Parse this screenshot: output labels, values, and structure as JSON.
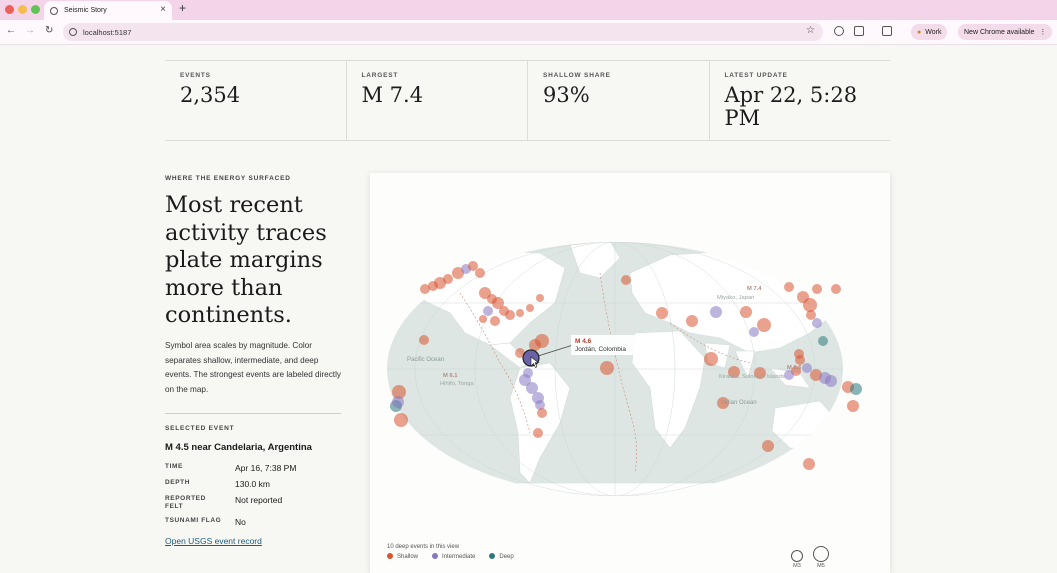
{
  "browser": {
    "tab_title": "Seismic Story",
    "url": "localhost:5187",
    "profile_label": "Work",
    "update_label": "New Chrome available"
  },
  "stats": [
    {
      "label": "EVENTS",
      "value": "2,354"
    },
    {
      "label": "LARGEST",
      "value": "M 7.4"
    },
    {
      "label": "SHALLOW SHARE",
      "value": "93%"
    },
    {
      "label": "LATEST UPDATE",
      "value": "Apr 22, 5:28 PM"
    }
  ],
  "story": {
    "kicker": "WHERE THE ENERGY SURFACED",
    "headline": "Most recent activity traces plate margins more than continents.",
    "description": "Symbol area scales by magnitude. Color separates shallow, intermediate, and deep events. The strongest events are labeled directly on the map."
  },
  "selected": {
    "section_label": "SELECTED EVENT",
    "title": "M 4.5 near Candelaria, Argentina",
    "fields": [
      {
        "key": "TIME",
        "value": "Apr 16, 7:38 PM"
      },
      {
        "key": "DEPTH",
        "value": "130.0 km"
      },
      {
        "key": "REPORTED FELT",
        "value": "Not reported"
      },
      {
        "key": "TSUNAMI FLAG",
        "value": "No"
      }
    ],
    "link_text": "Open USGS event record"
  },
  "map": {
    "ocean_labels": [
      "Pacific Ocean",
      "Indian Ocean"
    ],
    "callouts": [
      {
        "mag": "M 7.4",
        "place": "Miyako, Japan"
      },
      {
        "mag": "M 6.1",
        "place": "Hihifo, Tonga"
      },
      {
        "mag": "M 6.6",
        "place": "Kirakira, Solomon Islands"
      }
    ],
    "hover": {
      "mag": "M 4.6",
      "place": "Jordán, Colombia"
    },
    "legend_note": "10 deep events in this view",
    "legend": [
      {
        "label": "Shallow",
        "color": "#d9532f"
      },
      {
        "label": "Intermediate",
        "color": "#8878c2"
      },
      {
        "label": "Deep",
        "color": "#2c7a7b"
      }
    ],
    "size_keys": [
      "M3",
      "M5"
    ]
  }
}
